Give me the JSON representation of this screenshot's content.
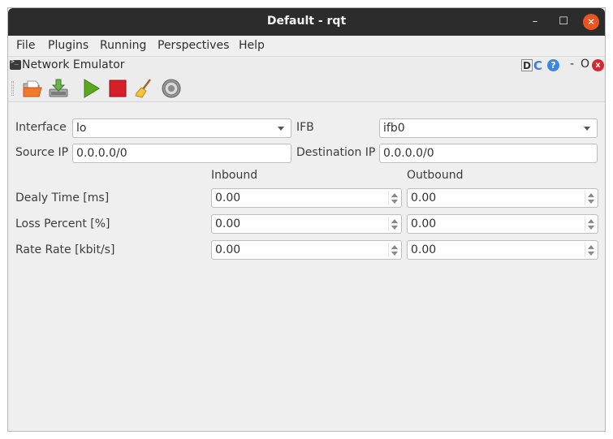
{
  "window": {
    "title": "Default - rqt",
    "controls": {
      "minimize": "–",
      "maximize": "☐",
      "close": "✕"
    }
  },
  "menu": {
    "items": [
      {
        "label": "File"
      },
      {
        "label": "Plugins"
      },
      {
        "label": "Running"
      },
      {
        "label": "Perspectives"
      },
      {
        "label": "Help"
      }
    ]
  },
  "dock": {
    "title": "Network Emulator",
    "d_label": "D",
    "reload_glyph": "C",
    "help_glyph": "?",
    "minimize_label": "-",
    "float_label": "O",
    "close_glyph": "x"
  },
  "toolbar": {
    "icons": [
      "open-folder-icon",
      "save-download-icon",
      "play-icon",
      "stop-icon",
      "broom-clear-icon",
      "gear-settings-icon"
    ]
  },
  "form": {
    "interface_label": "Interface",
    "interface_value": "lo",
    "ifb_label": "IFB",
    "ifb_value": "ifb0",
    "source_ip_label": "Source IP",
    "source_ip_value": "0.0.0.0/0",
    "destination_ip_label": "Destination IP",
    "destination_ip_value": "0.0.0.0/0",
    "inbound_header": "Inbound",
    "outbound_header": "Outbound",
    "rows": [
      {
        "label": "Dealy Time [ms]",
        "inbound": "0.00",
        "outbound": "0.00"
      },
      {
        "label": "Loss Percent [%]",
        "inbound": "0.00",
        "outbound": "0.00"
      },
      {
        "label": "Rate Rate [kbit/s]",
        "inbound": "0.00",
        "outbound": "0.00"
      }
    ]
  },
  "colors": {
    "titlebar": "#2c2c2c",
    "close_button": "#e95420",
    "play": "#5ea81e",
    "stop": "#d71f27"
  }
}
